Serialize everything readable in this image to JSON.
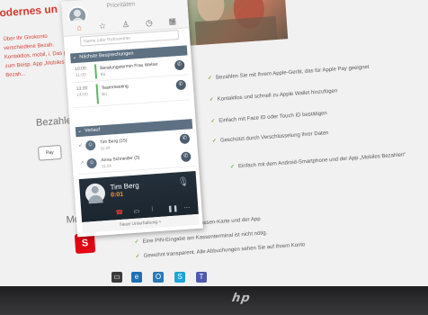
{
  "website": {
    "title": "odernes un",
    "intro": "Über Ihr Girokonto verschiedene Bezah. Kontaktlos, mobil, i. Das geht zum Beisp. App „Mobiles Bezah...",
    "section_pay": "Bezahlen mit A",
    "section_mobile": "Mobiles Bezah",
    "applepay_label": "Pay",
    "sparkasse_logo": "S",
    "bullets_top": [
      "Bezahlen Sie mit Ihrem Apple-Gerät, das für Apple Pay geeignet",
      "Kontaktlos und schnell zu Apple Wallet hinzufügen",
      "Einfach mit Face ID oder Touch ID bestätigen",
      "Geschützt durch Verschlüsselung Ihrer Daten"
    ],
    "bullets_mobile": [
      "Einfach mit dem Android-Smartphone und der App „Mobiles Bezahlen“",
      "Bezahlen mit Ihrer Sparkassen-Karte und der App",
      "Eine PIN-Eingabe am Kassenterminal ist nicht nötig.",
      "Gewohnt transparent. Alle Abbuchungen sehen Sie auf Ihrem Konto"
    ]
  },
  "softphone": {
    "presence_status": "Prioritäten",
    "search_placeholder": "Name oder Rufnummer",
    "tabs": [
      "home-icon",
      "star-icon",
      "contacts-icon",
      "history-icon",
      "calendar-icon"
    ],
    "meetings_header": "Nächste Besprechungen",
    "meetings": [
      {
        "time": "10:00",
        "end": "11:00",
        "name": "Beratungstermin Frau Weber",
        "sub": "Bü"
      },
      {
        "time": "13:00",
        "end": "14:00",
        "name": "Teammeeting",
        "sub": "Bü"
      }
    ],
    "history_header": "Verlauf",
    "history": [
      {
        "name": "Tim Berg (15)",
        "sub": "11:24"
      },
      {
        "name": "Anna Schneider (3)",
        "sub": "11:24"
      }
    ],
    "active_call": {
      "name": "Tim Berg",
      "timer": "0:01"
    },
    "footer": "Neue Unterhaltung +"
  },
  "hardware": {
    "logo": "hp"
  }
}
